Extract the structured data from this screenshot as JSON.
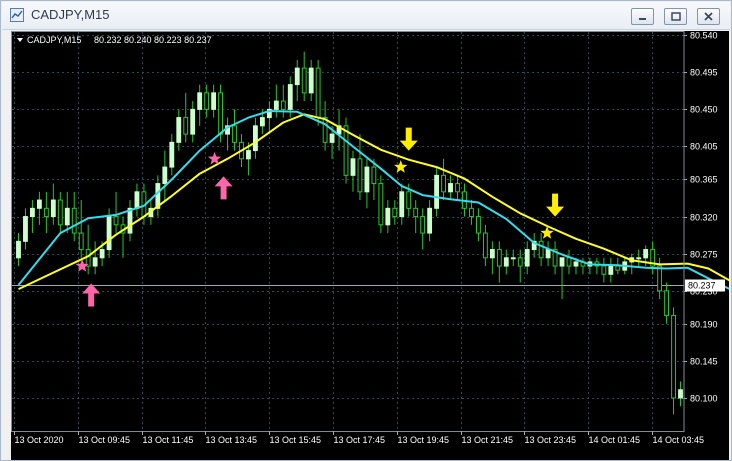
{
  "window": {
    "title": "CADJPY,M15"
  },
  "chart_header": {
    "symbol_tf": "CADJPY,M15",
    "ohlc": "80.232 80.240 80.223 80.237"
  },
  "price_axis": {
    "labels": [
      "80.540",
      "80.495",
      "80.450",
      "80.405",
      "80.365",
      "80.320",
      "80.275",
      "80.230",
      "80.190",
      "80.145",
      "80.100"
    ],
    "label_values": [
      80.54,
      80.495,
      80.45,
      80.405,
      80.365,
      80.32,
      80.275,
      80.23,
      80.19,
      80.145,
      80.1
    ],
    "current_price_label": "80.237",
    "current_price": 80.237
  },
  "time_axis": {
    "labels": [
      "13 Oct 2020",
      "13 Oct 09:45",
      "13 Oct 11:45",
      "13 Oct 13:45",
      "13 Oct 15:45",
      "13 Oct 17:45",
      "13 Oct 19:45",
      "13 Oct 21:45",
      "13 Oct 23:45",
      "14 Oct 01:45",
      "14 Oct 03:45"
    ]
  },
  "colors": {
    "background": "#000000",
    "grid": "#2c4a5a",
    "candle": "#ccffcc",
    "wick": "#22cc22",
    "fast_ma": "#33ddee",
    "slow_ma": "#ffff22",
    "buy_arrow": "#ff66aa",
    "sell_arrow": "#ffee00",
    "price_line": "#9aaab0"
  },
  "chart_data": {
    "type": "candlestick",
    "symbol": "CADJPY",
    "timeframe": "M15",
    "ylim": [
      80.06,
      80.545
    ],
    "grid": true,
    "candles": [
      [
        80.27,
        80.3,
        80.26,
        80.29
      ],
      [
        80.29,
        80.33,
        80.28,
        80.32
      ],
      [
        80.32,
        80.34,
        80.3,
        80.33
      ],
      [
        80.33,
        80.35,
        80.31,
        80.34
      ],
      [
        80.33,
        80.35,
        80.3,
        80.32
      ],
      [
        80.32,
        80.36,
        80.31,
        80.34
      ],
      [
        80.34,
        80.35,
        80.3,
        80.31
      ],
      [
        80.31,
        80.35,
        80.3,
        80.33
      ],
      [
        80.33,
        80.35,
        80.29,
        80.3
      ],
      [
        80.3,
        80.34,
        80.27,
        80.28
      ],
      [
        80.28,
        80.31,
        80.25,
        80.26
      ],
      [
        80.26,
        80.29,
        80.25,
        80.27
      ],
      [
        80.27,
        80.29,
        80.26,
        80.28
      ],
      [
        80.28,
        80.33,
        80.27,
        80.32
      ],
      [
        80.32,
        80.35,
        80.3,
        80.31
      ],
      [
        80.31,
        80.32,
        80.27,
        80.3
      ],
      [
        80.3,
        80.34,
        80.29,
        80.33
      ],
      [
        80.33,
        80.36,
        80.32,
        80.35
      ],
      [
        80.35,
        80.36,
        80.31,
        80.32
      ],
      [
        80.32,
        80.34,
        80.31,
        80.33
      ],
      [
        80.33,
        80.37,
        80.32,
        80.36
      ],
      [
        80.36,
        80.4,
        80.34,
        80.38
      ],
      [
        80.38,
        80.42,
        80.37,
        80.41
      ],
      [
        80.41,
        80.45,
        80.4,
        80.44
      ],
      [
        80.44,
        80.47,
        80.41,
        80.42
      ],
      [
        80.42,
        80.46,
        80.41,
        80.45
      ],
      [
        80.45,
        80.48,
        80.43,
        80.47
      ],
      [
        80.47,
        80.48,
        80.44,
        80.45
      ],
      [
        80.45,
        80.48,
        80.44,
        80.47
      ],
      [
        80.47,
        80.48,
        80.41,
        80.42
      ],
      [
        80.42,
        80.44,
        80.4,
        80.43
      ],
      [
        80.43,
        80.45,
        80.4,
        80.41
      ],
      [
        80.41,
        80.42,
        80.38,
        80.39
      ],
      [
        80.39,
        80.41,
        80.37,
        80.4
      ],
      [
        80.4,
        80.44,
        80.39,
        80.43
      ],
      [
        80.43,
        80.45,
        80.42,
        80.44
      ],
      [
        80.44,
        80.46,
        80.42,
        80.45
      ],
      [
        80.45,
        80.48,
        80.44,
        80.46
      ],
      [
        80.46,
        80.48,
        80.44,
        80.45
      ],
      [
        80.45,
        80.49,
        80.44,
        80.48
      ],
      [
        80.48,
        80.51,
        80.46,
        80.5
      ],
      [
        80.5,
        80.52,
        80.46,
        80.47
      ],
      [
        80.47,
        80.51,
        80.46,
        80.5
      ],
      [
        80.5,
        80.51,
        80.43,
        80.44
      ],
      [
        80.44,
        80.46,
        80.4,
        80.41
      ],
      [
        80.41,
        80.43,
        80.39,
        80.42
      ],
      [
        80.42,
        80.45,
        80.4,
        80.43
      ],
      [
        80.43,
        80.44,
        80.36,
        80.37
      ],
      [
        80.37,
        80.4,
        80.35,
        80.39
      ],
      [
        80.39,
        80.42,
        80.34,
        80.35
      ],
      [
        80.35,
        80.39,
        80.33,
        80.38
      ],
      [
        80.38,
        80.39,
        80.34,
        80.36
      ],
      [
        80.36,
        80.37,
        80.3,
        80.31
      ],
      [
        80.31,
        80.34,
        80.3,
        80.33
      ],
      [
        80.33,
        80.34,
        80.31,
        80.32
      ],
      [
        80.32,
        80.36,
        80.31,
        80.35
      ],
      [
        80.35,
        80.36,
        80.32,
        80.33
      ],
      [
        80.33,
        80.34,
        80.3,
        80.32
      ],
      [
        80.32,
        80.33,
        80.28,
        80.3
      ],
      [
        80.3,
        80.34,
        80.29,
        80.33
      ],
      [
        80.33,
        80.38,
        80.32,
        80.37
      ],
      [
        80.37,
        80.39,
        80.34,
        80.35
      ],
      [
        80.35,
        80.37,
        80.34,
        80.36
      ],
      [
        80.36,
        80.37,
        80.34,
        80.35
      ],
      [
        80.35,
        80.36,
        80.32,
        80.33
      ],
      [
        80.33,
        80.34,
        80.31,
        80.32
      ],
      [
        80.32,
        80.33,
        80.29,
        80.3
      ],
      [
        80.3,
        80.31,
        80.26,
        80.27
      ],
      [
        80.27,
        80.29,
        80.25,
        80.28
      ],
      [
        80.28,
        80.29,
        80.24,
        80.26
      ],
      [
        80.26,
        80.28,
        80.25,
        80.27
      ],
      [
        80.27,
        80.28,
        80.26,
        80.27
      ],
      [
        80.27,
        80.28,
        80.24,
        80.26
      ],
      [
        80.26,
        80.29,
        80.25,
        80.28
      ],
      [
        80.28,
        80.3,
        80.27,
        80.29
      ],
      [
        80.29,
        80.3,
        80.26,
        80.27
      ],
      [
        80.27,
        80.29,
        80.26,
        80.28
      ],
      [
        80.28,
        80.29,
        80.25,
        80.26
      ],
      [
        80.26,
        80.27,
        80.22,
        80.27
      ],
      [
        80.27,
        80.28,
        80.25,
        80.26
      ],
      [
        80.26,
        80.27,
        80.25,
        80.265
      ],
      [
        80.265,
        80.27,
        80.25,
        80.26
      ],
      [
        80.26,
        80.27,
        80.25,
        80.265
      ],
      [
        80.265,
        80.27,
        80.25,
        80.26
      ],
      [
        80.26,
        80.27,
        80.24,
        80.25
      ],
      [
        80.25,
        80.27,
        80.24,
        80.26
      ],
      [
        80.26,
        80.27,
        80.25,
        80.255
      ],
      [
        80.255,
        80.27,
        80.25,
        80.265
      ],
      [
        80.265,
        80.275,
        80.25,
        80.27
      ],
      [
        80.27,
        80.28,
        80.26,
        80.27
      ],
      [
        80.27,
        80.285,
        80.26,
        80.28
      ],
      [
        80.28,
        80.29,
        80.25,
        80.26
      ],
      [
        80.26,
        80.27,
        80.22,
        80.23
      ],
      [
        80.23,
        80.24,
        80.19,
        80.2
      ],
      [
        80.2,
        80.21,
        80.08,
        80.1
      ],
      [
        80.1,
        80.12,
        80.09,
        80.11
      ]
    ],
    "fast_ma": [
      [
        0,
        80.237
      ],
      [
        6,
        80.3
      ],
      [
        10,
        80.318
      ],
      [
        14,
        80.322
      ],
      [
        18,
        80.333
      ],
      [
        22,
        80.365
      ],
      [
        26,
        80.4
      ],
      [
        30,
        80.428
      ],
      [
        33,
        80.44
      ],
      [
        36,
        80.448
      ],
      [
        40,
        80.447
      ],
      [
        44,
        80.432
      ],
      [
        48,
        80.405
      ],
      [
        52,
        80.378
      ],
      [
        55,
        80.357
      ],
      [
        58,
        80.346
      ],
      [
        62,
        80.341
      ],
      [
        66,
        80.337
      ],
      [
        70,
        80.317
      ],
      [
        74,
        80.288
      ],
      [
        78,
        80.274
      ],
      [
        82,
        80.262
      ],
      [
        86,
        80.261
      ],
      [
        90,
        80.258
      ],
      [
        93,
        80.257
      ],
      [
        96,
        80.258
      ],
      [
        99,
        80.245
      ],
      [
        103,
        80.228
      ]
    ],
    "slow_ma": [
      [
        0,
        80.232
      ],
      [
        5,
        80.252
      ],
      [
        10,
        80.272
      ],
      [
        14,
        80.298
      ],
      [
        18,
        80.32
      ],
      [
        22,
        80.345
      ],
      [
        26,
        80.372
      ],
      [
        30,
        80.39
      ],
      [
        34,
        80.41
      ],
      [
        38,
        80.434
      ],
      [
        41,
        80.444
      ],
      [
        44,
        80.438
      ],
      [
        48,
        80.419
      ],
      [
        52,
        80.401
      ],
      [
        56,
        80.389
      ],
      [
        60,
        80.38
      ],
      [
        64,
        80.366
      ],
      [
        68,
        80.344
      ],
      [
        72,
        80.324
      ],
      [
        76,
        80.308
      ],
      [
        80,
        80.293
      ],
      [
        84,
        80.281
      ],
      [
        88,
        80.267
      ],
      [
        92,
        80.262
      ],
      [
        96,
        80.263
      ],
      [
        99,
        80.257
      ],
      [
        103,
        80.238
      ]
    ],
    "buy_signals": [
      {
        "index": 10,
        "star": 80.26,
        "arrow": 80.24
      },
      {
        "index": 29,
        "star": 80.39,
        "arrow": 80.37
      }
    ],
    "sell_signals": [
      {
        "index": 56,
        "star": 80.38,
        "arrow": 80.4
      },
      {
        "index": 77,
        "star": 80.3,
        "arrow": 80.32
      }
    ]
  }
}
